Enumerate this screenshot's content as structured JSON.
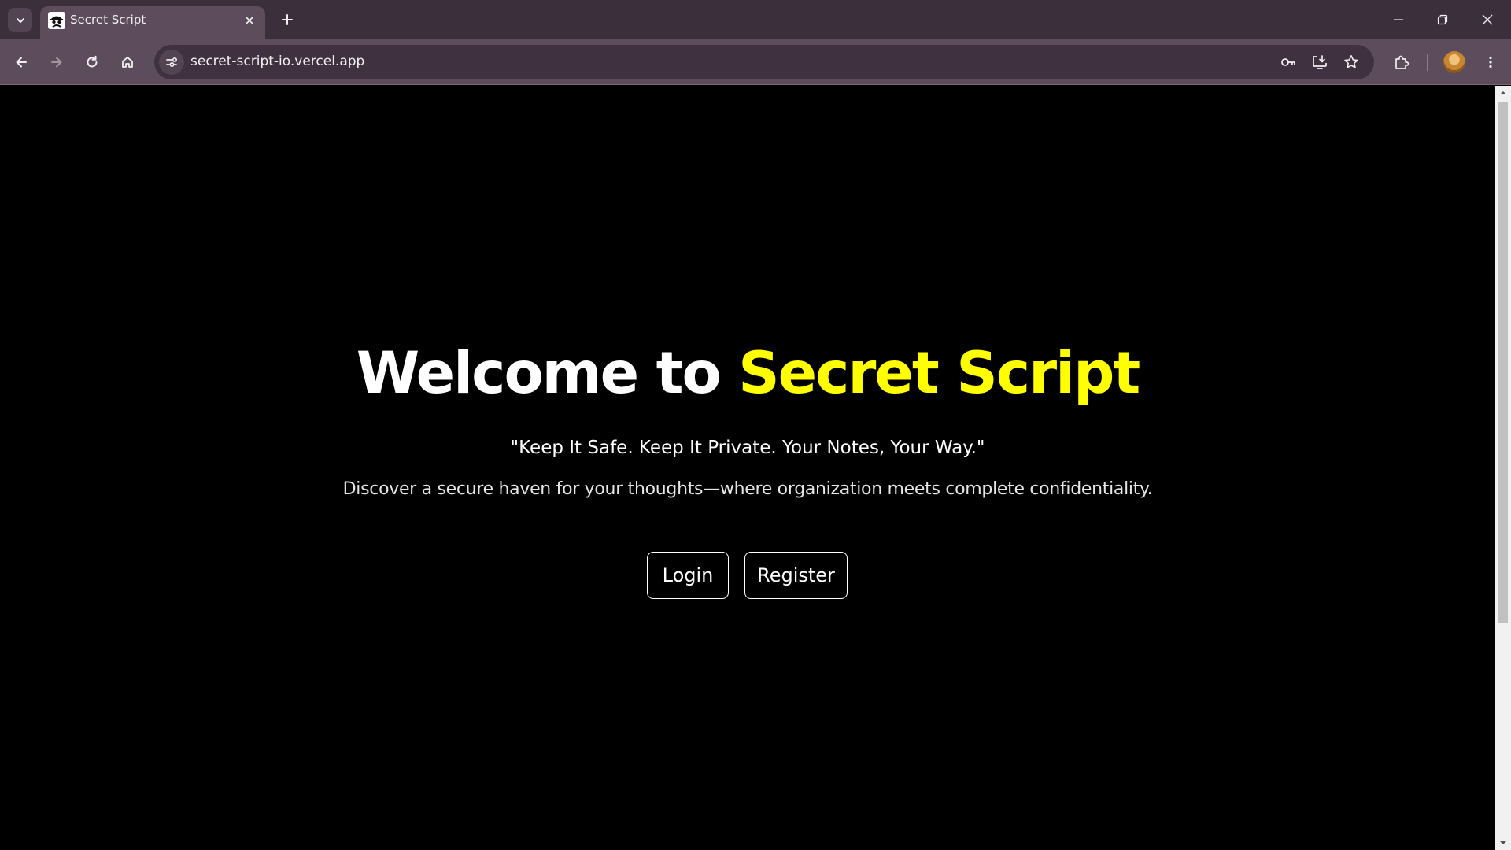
{
  "browser": {
    "tab": {
      "title": "Secret Script",
      "favicon_icon": "spy-mask-icon",
      "close_icon": "close-icon"
    },
    "new_tab_icon": "plus-icon",
    "tab_search_icon": "chevron-down-icon",
    "url": "secret-script-io.vercel.app",
    "toolbar_icons": [
      "back-arrow-icon",
      "forward-arrow-icon",
      "reload-icon",
      "home-icon",
      "site-info-icon",
      "password-key-icon",
      "install-app-icon",
      "bookmark-star-icon",
      "extensions-puzzle-icon",
      "profile-avatar",
      "kebab-menu-icon"
    ],
    "window_controls": [
      "minimize-icon",
      "restore-icon",
      "close-window-icon"
    ]
  },
  "page": {
    "hero": {
      "title_prefix": "Welcome to ",
      "title_accent": "Secret Script",
      "tagline": "\"Keep It Safe. Keep It Private. Your Notes, Your Way.\"",
      "description": "Discover a secure haven for your thoughts—where organization meets complete confidentiality."
    },
    "buttons": {
      "login_label": "Login",
      "register_label": "Register"
    }
  },
  "colors": {
    "accent": "#ffff00",
    "background": "#000000",
    "text": "#ffffff",
    "chrome": "#3c2f3c",
    "toolbar": "#5c4c5c"
  }
}
